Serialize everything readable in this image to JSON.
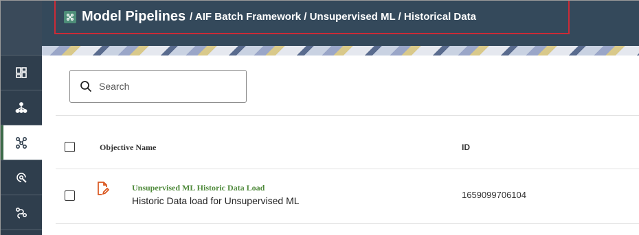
{
  "header": {
    "title": "Model Pipelines",
    "breadcrumb": "/ AIF Batch Framework / Unsupervised ML / Historical Data",
    "title_icon": "pipeline-icon"
  },
  "sidebar": {
    "items": [
      {
        "icon": "dashboard-icon"
      },
      {
        "icon": "hierarchy-icon"
      },
      {
        "icon": "pipeline-icon",
        "active": true
      },
      {
        "icon": "target-cursor-icon"
      },
      {
        "icon": "workflow-icon"
      }
    ]
  },
  "search": {
    "placeholder": "Search"
  },
  "table": {
    "columns": [
      "Objective Name",
      "ID"
    ],
    "rows": [
      {
        "name": "Unsupervised ML Historic Data Load",
        "description": "Historic Data load for Unsupervised ML",
        "id": "1659099706104",
        "icon": "edit-document-icon"
      }
    ]
  },
  "colors": {
    "header_bg": "#34495b",
    "sidebar_bg": "#2f3e4d",
    "highlight_outline": "#cc2b36",
    "link_green": "#4f8a3b"
  }
}
